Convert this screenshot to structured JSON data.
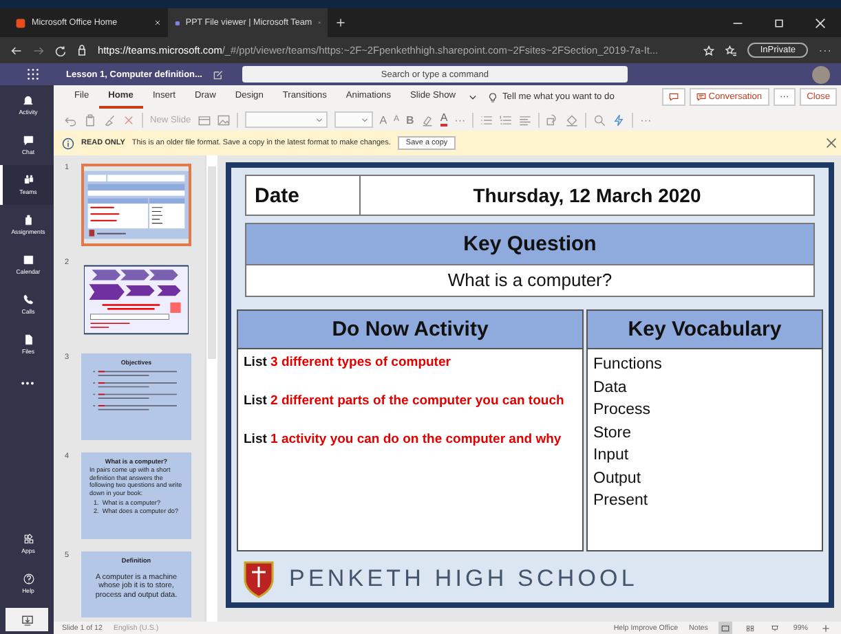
{
  "browser_tabs": [
    {
      "title": "Microsoft Office Home",
      "selected": false
    },
    {
      "title": "PPT File viewer | Microsoft Team",
      "selected": true
    }
  ],
  "address_bar": {
    "url_host": "https://teams.microsoft.com",
    "url_path": "/_#/ppt/viewer/teams/https:~2F~2Fpenkethhigh.sharepoint.com~2Fsites~2FSection_2019-7a-It...",
    "inprivate": "InPrivate"
  },
  "teams_bar": {
    "title": "Lesson 1, Computer definition...",
    "search_placeholder": "Search or type a command"
  },
  "app_rail": [
    {
      "label": "Activity",
      "kind": "bell",
      "selected": false
    },
    {
      "label": "Chat",
      "kind": "chat",
      "selected": false
    },
    {
      "label": "Teams",
      "kind": "teams",
      "selected": true
    },
    {
      "label": "Assignments",
      "kind": "bag",
      "selected": false
    },
    {
      "label": "Calendar",
      "kind": "calendar",
      "selected": false
    },
    {
      "label": "Calls",
      "kind": "phone",
      "selected": false
    },
    {
      "label": "Files",
      "kind": "file",
      "selected": false
    },
    {
      "label": "•••",
      "kind": "more",
      "selected": false
    }
  ],
  "app_rail_bottom": [
    {
      "label": "Apps",
      "kind": "apps"
    },
    {
      "label": "Help",
      "kind": "help"
    }
  ],
  "ribbon_tabs": [
    {
      "label": "File",
      "selected": false
    },
    {
      "label": "Home",
      "selected": true
    },
    {
      "label": "Insert",
      "selected": false
    },
    {
      "label": "Draw",
      "selected": false
    },
    {
      "label": "Design",
      "selected": false
    },
    {
      "label": "Transitions",
      "selected": false
    },
    {
      "label": "Animations",
      "selected": false
    },
    {
      "label": "Slide Show",
      "selected": false
    }
  ],
  "tell_me": "Tell me what you want to do",
  "conversation_button": "Conversation",
  "more_button": "···",
  "close_button": "Close",
  "tools": [
    {
      "kind": "undo"
    },
    {
      "kind": "clipboard"
    },
    {
      "kind": "brush"
    },
    {
      "kind": "delete"
    },
    {
      "kind": "sep"
    },
    {
      "kind": "newslide",
      "label": "New Slide"
    },
    {
      "kind": "layout"
    },
    {
      "kind": "picture"
    },
    {
      "kind": "sep"
    },
    {
      "kind": "fontbox"
    },
    {
      "kind": "sizebox"
    },
    {
      "kind": "grow",
      "label": "A"
    },
    {
      "kind": "shrink",
      "label": "A"
    },
    {
      "kind": "bold",
      "label": "B"
    },
    {
      "kind": "highlight"
    },
    {
      "kind": "fontcolor",
      "label": "A"
    },
    {
      "kind": "more",
      "label": "···"
    },
    {
      "kind": "sep"
    },
    {
      "kind": "bullets"
    },
    {
      "kind": "numbering"
    },
    {
      "kind": "align"
    },
    {
      "kind": "sep"
    },
    {
      "kind": "shapes"
    },
    {
      "kind": "fill"
    },
    {
      "kind": "sep"
    },
    {
      "kind": "find"
    },
    {
      "kind": "lightning"
    },
    {
      "kind": "sep"
    },
    {
      "kind": "more",
      "label": "···"
    }
  ],
  "readonly_bar": {
    "label": "READ ONLY",
    "message": "This is an older file format. Save a copy in the latest format to make changes.",
    "button": "Save a copy"
  },
  "thumbnails": [
    {
      "number": "1",
      "selected": true,
      "kind": "slide-one"
    },
    {
      "number": "2",
      "selected": false,
      "kind": "slide-two"
    },
    {
      "number": "3",
      "selected": false,
      "kind": "objectives",
      "title": "Objectives"
    },
    {
      "number": "4",
      "selected": false,
      "kind": "question",
      "title": "What is a computer?",
      "body": "In pairs come up with a short definition that answers the following two questions and write down in your book:",
      "items": [
        "1.  What is a computer?",
        "2.  What does a computer do?"
      ]
    },
    {
      "number": "5",
      "selected": false,
      "kind": "definition",
      "title": "Definition",
      "body": "A computer is a machine whose job it is to store, process and output data."
    }
  ],
  "slide": {
    "date_label": "Date",
    "date_value": "Thursday, 12 March 2020",
    "key_question_heading": "Key Question",
    "key_question": "What is a computer?",
    "activity_heading": "Do Now Activity",
    "activities": [
      {
        "lead": "List ",
        "highlight": "3 different types of computer"
      },
      {
        "lead": "List ",
        "highlight": "2 different parts of the computer you can touch"
      },
      {
        "lead": "List ",
        "highlight": "1  activity you can do on the computer and why"
      }
    ],
    "vocabulary_heading": "Key Vocabulary",
    "vocabulary": [
      "Functions",
      "Data",
      "Process",
      "Store",
      "Input",
      "Output",
      "Present"
    ],
    "school": "PENKETH HIGH SCHOOL"
  },
  "status_bar": {
    "slide": "Slide 1 of 12",
    "language": "English (U.S.)",
    "help": "Help Improve Office",
    "notes": "Notes",
    "zoom": "99%"
  }
}
